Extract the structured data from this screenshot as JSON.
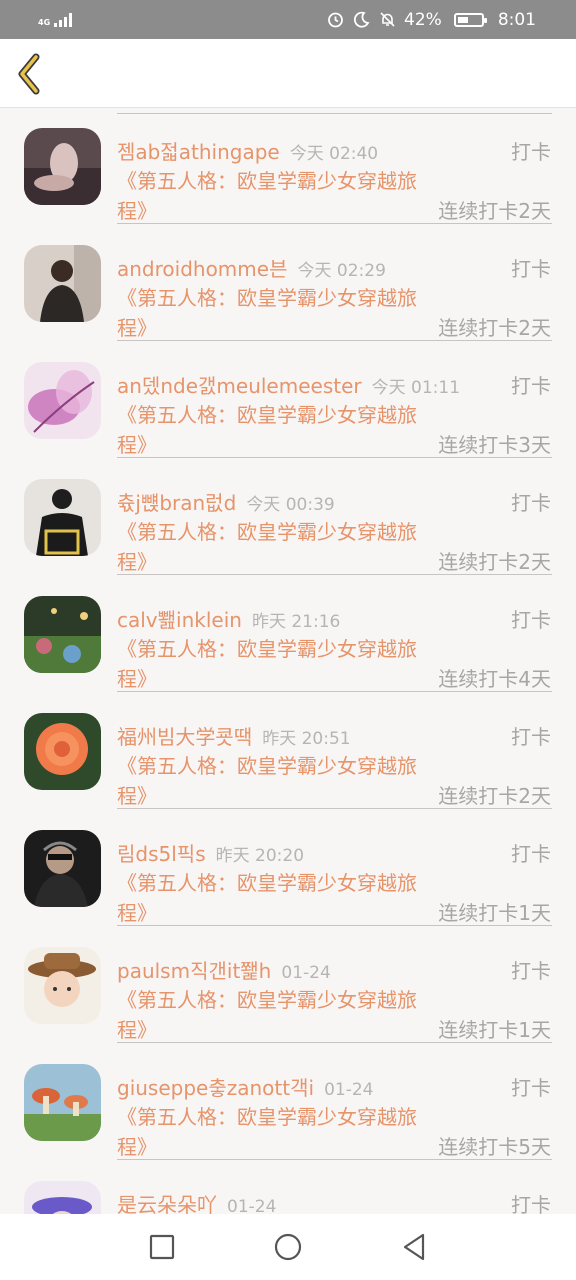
{
  "status_bar": {
    "network": "4G",
    "battery_percent": "42%",
    "time": "8:01",
    "icons": [
      "signal-icon",
      "alarm-icon",
      "moon-icon",
      "mute-bell-icon",
      "battery-icon"
    ]
  },
  "header": {
    "back_icon": "chevron-left-icon"
  },
  "list": {
    "items": [
      {
        "name": "젬ab젋athingape",
        "time": "今天 02:40",
        "action": "打卡",
        "book": "《第五人格：欧皇学霸少女穿越旅程》",
        "streak": "连续打卡2天"
      },
      {
        "name": "androidhomme븐",
        "time": "今天 02:29",
        "action": "打卡",
        "book": "《第五人格：欧皇学霸少女穿越旅程》",
        "streak": "连续打卡2天"
      },
      {
        "name": "an뎄nde갨meulemeester",
        "time": "今天 01:11",
        "action": "打卡",
        "book": "《第五人格：欧皇学霸少女穿越旅程》",
        "streak": "连续打卡3天"
      },
      {
        "name": "츇j뺹bran럾d",
        "time": "今天 00:39",
        "action": "打卡",
        "book": "《第五人格：欧皇学霸少女穿越旅程》",
        "streak": "连续打卡2天"
      },
      {
        "name": "calv뾆inklein",
        "time": "昨天 21:16",
        "action": "打卡",
        "book": "《第五人格：欧皇学霸少女穿越旅程》",
        "streak": "连续打卡4天"
      },
      {
        "name": "福州빔大学쿗땍",
        "time": "昨天 20:51",
        "action": "打卡",
        "book": "《第五人格：欧皇学霸少女穿越旅程》",
        "streak": "连续打卡2天"
      },
      {
        "name": "림ds5l픽s",
        "time": "昨天 20:20",
        "action": "打卡",
        "book": "《第五人格：欧皇学霸少女穿越旅程》",
        "streak": "连续打卡1天"
      },
      {
        "name": "paulsm직갠it쬁h",
        "time": "01-24",
        "action": "打卡",
        "book": "《第五人格：欧皇学霸少女穿越旅程》",
        "streak": "连续打卡1天"
      },
      {
        "name": "giuseppe춯zanott객i",
        "time": "01-24",
        "action": "打卡",
        "book": "《第五人格：欧皇学霸少女穿越旅程》",
        "streak": "连续打卡5天"
      },
      {
        "name": "是云朵朵吖",
        "time": "01-24",
        "action": "打卡",
        "book": "",
        "streak": ""
      }
    ]
  },
  "nav_bar": {
    "icons": [
      "recent-apps-icon",
      "home-icon",
      "back-triangle-icon"
    ]
  },
  "colors": {
    "accent": "#e6946a",
    "muted": "#aaa5a5",
    "status_bar": "#8c8c8c",
    "back_chevron": "#e8c24a"
  }
}
